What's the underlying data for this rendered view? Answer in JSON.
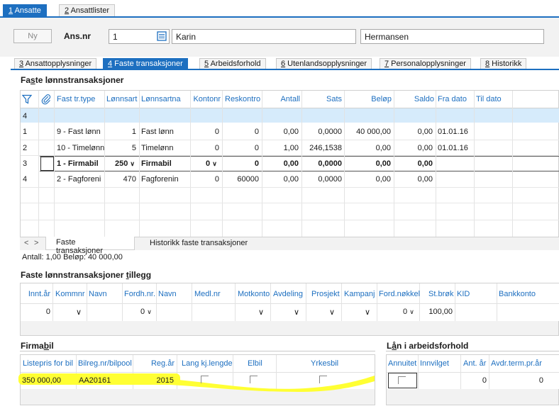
{
  "top_tabs": [
    {
      "num": "1",
      "label": " Ansatte"
    },
    {
      "num": "2",
      "label": " Ansattlister"
    }
  ],
  "header": {
    "ny_button": "Ny",
    "ansnr_label": "Ans.nr",
    "ansnr_value": "1",
    "first_name": "Karin",
    "last_name": "Hermansen"
  },
  "sub_tabs": [
    {
      "num": "3",
      "label": " Ansattopplysninger"
    },
    {
      "num": "4",
      "label": " Faste transaksjoner"
    },
    {
      "num": "5",
      "label": " Arbeidsforhold"
    },
    {
      "num": "6",
      "label": " Utenlandsopplysninger"
    },
    {
      "num": "7",
      "label": " Personalopplysninger"
    },
    {
      "num": "8",
      "label": " Historikk"
    }
  ],
  "faste": {
    "title_pre": "Fa",
    "title_u": "s",
    "title_post": "te lønnstransaksjoner",
    "columns": [
      "Fast tr.type",
      "Lønnsart",
      "Lønnsartna",
      "Kontonr",
      "Reskontro",
      "Antall",
      "Sats",
      "Beløp",
      "Saldo",
      "Fra dato",
      "Til dato"
    ],
    "count_row": "4",
    "rows": [
      {
        "rownum": "1",
        "type": "9 - Fast lønn",
        "lonnsart": "1",
        "navn": "Fast lønn",
        "konto": "0",
        "resk": "0",
        "antall": "0,00",
        "sats": "0,0000",
        "belop": "40 000,00",
        "saldo": "0,00",
        "fra": "01.01.16",
        "til": ""
      },
      {
        "rownum": "2",
        "type": "10 - Timelønn",
        "lonnsart": "5",
        "navn": "Timelønn",
        "konto": "0",
        "resk": "0",
        "antall": "1,00",
        "sats": "246,1538",
        "belop": "0,00",
        "saldo": "0,00",
        "fra": "01.01.16",
        "til": ""
      },
      {
        "rownum": "3",
        "type": "1 - Firmabil",
        "lonnsart": "250",
        "navn": "Firmabil",
        "konto": "0",
        "resk": "0",
        "antall": "0,00",
        "sats": "0,0000",
        "belop": "0,00",
        "saldo": "0,00",
        "fra": "",
        "til": ""
      },
      {
        "rownum": "4",
        "type": "2 - Fagforeni",
        "lonnsart": "470",
        "navn": "Fagforenin",
        "konto": "0",
        "resk": "60000",
        "antall": "0,00",
        "sats": "0,0000",
        "belop": "0,00",
        "saldo": "0,00",
        "fra": "",
        "til": ""
      }
    ],
    "bottom_tabs": [
      "Faste transaksjoner",
      "Historikk faste transaksjoner"
    ],
    "nav_prev": "<",
    "nav_next": ">",
    "summary": "Antall: 1,00  Beløp: 40 000,00"
  },
  "tillegg": {
    "title_pre": "Faste lønnstransaksjoner ",
    "title_u": "t",
    "title_post": "illegg",
    "columns": [
      "Innt.år",
      "Kommnr",
      "Navn",
      "Fordh.nr.",
      "Navn",
      "Medl.nr",
      "Motkonto",
      "Avdeling",
      "Prosjekt",
      "Kampanj",
      "Ford.nøkkel",
      "St.brøk",
      "KID",
      "Bankkonto"
    ],
    "row": {
      "inntar": "0",
      "fordh": "0",
      "fordnokkel": "0",
      "stbrok": "100,00"
    }
  },
  "firmabil": {
    "title_pre": "Firma",
    "title_u": "b",
    "title_post": "il",
    "columns": [
      "Listepris for bil",
      "Bilreg.nr/bilpool",
      "Reg.år",
      "Lang kj.lengde",
      "Elbil",
      "Yrkesbil"
    ],
    "row": {
      "listepris": "350 000,00",
      "bilreg": "AA20161",
      "regar": "2015"
    }
  },
  "lan": {
    "title_pre": "L",
    "title_u": "å",
    "title_post": "n i arbeidsforhold",
    "columns": [
      "Annuitet",
      "Innvilget",
      "Ant. år",
      "Avdr.term.pr.år"
    ],
    "row": {
      "ant_ar": "0",
      "avdr": "0"
    }
  },
  "colors": {
    "accent": "#1d6fc0",
    "highlight": "#ffff33",
    "header_row": "#d6ebfb"
  }
}
